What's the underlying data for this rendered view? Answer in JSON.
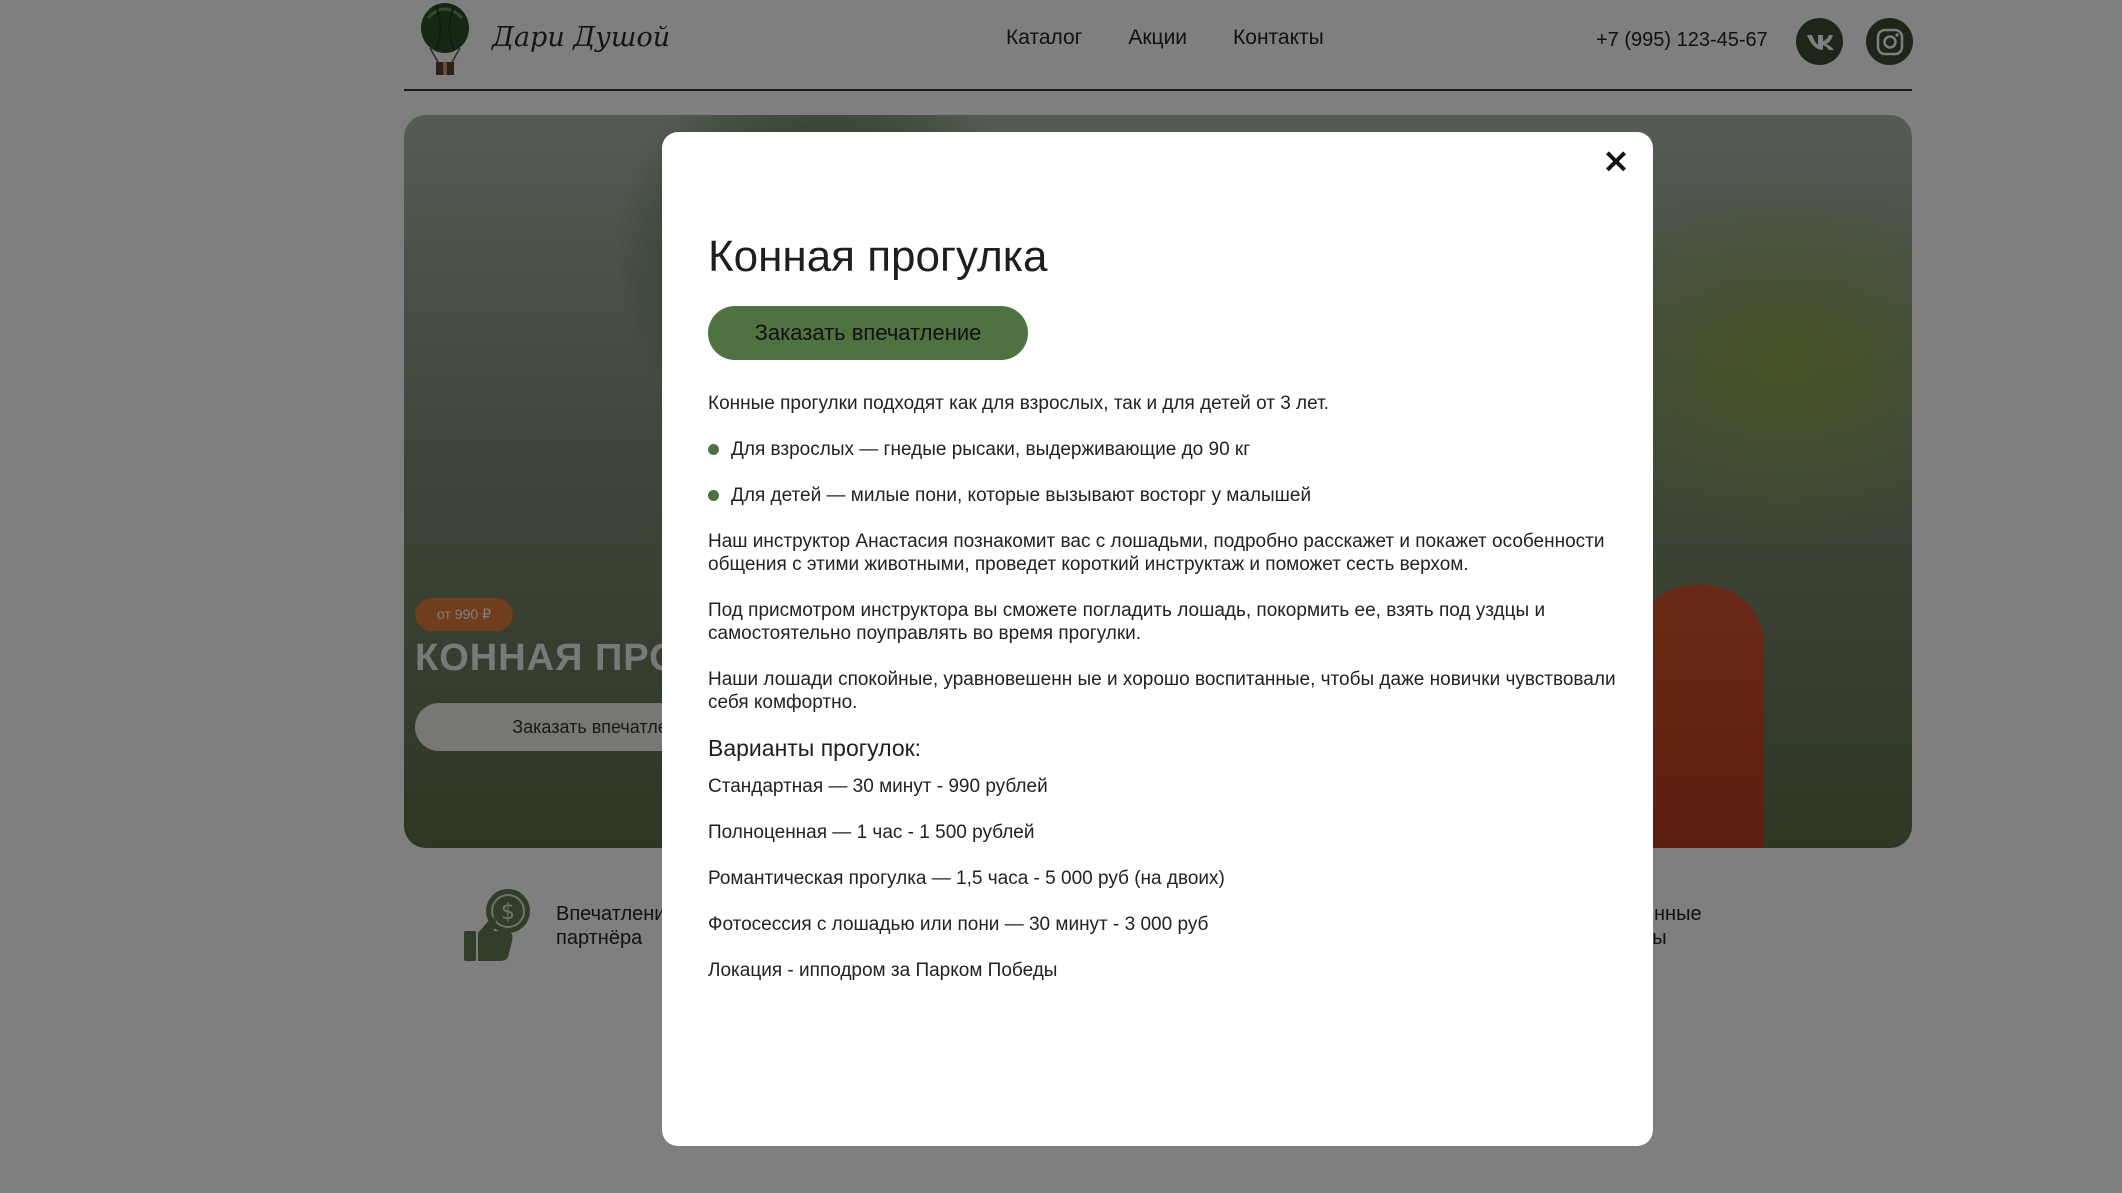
{
  "header": {
    "logo_text": "Дари Душой",
    "nav": [
      "Каталог",
      "Акции",
      "Контакты"
    ],
    "phone": "+7 (995) 123-45-67",
    "social": [
      "vk-icon",
      "instagram-icon"
    ]
  },
  "hero": {
    "price_badge": "от 990 ₽",
    "title": "КОННАЯ ПРОГ",
    "button": "Заказать впечатлен"
  },
  "features": [
    {
      "icon": "thumbs-up-coin-icon",
      "line1": "Впечатлени",
      "line2": "партнёра"
    },
    {
      "icon": "",
      "line1": "роверенные",
      "line2": "артнёры"
    }
  ],
  "modal": {
    "close_glyph": "×",
    "title": "Конная прогулка",
    "order_button": "Заказать впечатление",
    "intro": "Конные прогулки подходят как для взрослых, так и для детей от 3 лет.",
    "bullets": [
      "Для взрослых — гнедые рысаки, выдерживающие до 90 кг",
      "Для детей — милые пони, которые вызывают восторг у малышей"
    ],
    "paragraphs": [
      "Наш инструктор Анастасия познакомит вас с лошадьми, подробно расскажет и покажет особенности общения с этими животными, проведет короткий инструктаж и поможет сесть верхом.",
      "Под присмотром инструктора вы сможете погладить лошадь, покормить ее, взять под уздцы и самостоятельно поуправлять во время прогулки.",
      "Наши лошади спокойные, уравновешенн ые и хорошо воспитанные, чтобы даже новички чувствовали себя комфортно."
    ],
    "variants_title": "Варианты прогулок:",
    "variants": [
      "Стандартная — 30 минут - 990 рублей",
      "Полноценная — 1 час - 1 500 рублей",
      "Романтическая прогулка — 1,5 часа - 5 000 руб (на двоих)",
      "Фотосессия с лошадью или пони — 30 минут - 3 000 руб",
      "Локация - иппод­ром за Парком Победы"
    ]
  },
  "colors": {
    "accent_green": "#4f7340",
    "social_bg": "#3c4a32",
    "badge_orange": "#e07a3b"
  }
}
